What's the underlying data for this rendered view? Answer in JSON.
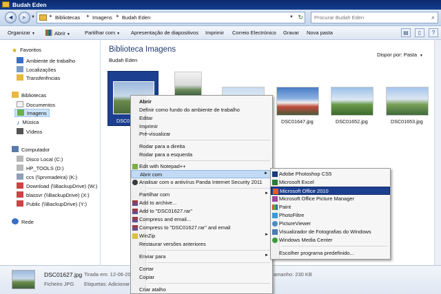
{
  "window": {
    "title": "Budah Eden"
  },
  "address": {
    "breadcrumbs": [
      "Bibliotecas",
      "Imagens",
      "Budah Eden"
    ],
    "search_placeholder": "Procurar Budah Eden"
  },
  "toolbar": {
    "items": [
      "Organizar",
      "Abrir",
      "Partilhar com",
      "Apresentação de diapositivos",
      "Imprimir",
      "Correio Electrónico",
      "Gravar",
      "Nova pasta"
    ]
  },
  "sidebar": {
    "favorites": {
      "label": "Favoritos",
      "items": [
        "Ambiente de trabalho",
        "Localizações",
        "Transferências"
      ]
    },
    "libraries": {
      "label": "Bibliotecas",
      "items": [
        "Documentos",
        "Imagens",
        "Música",
        "Vídeos"
      ]
    },
    "computer": {
      "label": "Computador",
      "items": [
        "Disco Local (C:)",
        "HP_TOOLS (D:)",
        "ccs (\\\\prvmadeira) (K:)",
        "Download (\\\\BackupDrive) (W:)",
        "blassvr (\\\\BackupDrive) (X:)",
        "Public (\\\\BackupDrive) (Y:)"
      ]
    },
    "network": {
      "label": "Rede"
    }
  },
  "main": {
    "library_title": "Biblioteca Imagens",
    "library_subtitle": "Budah Eden",
    "arrange_label": "Dispor por:",
    "arrange_value": "Pasta",
    "files": [
      {
        "name": "DSC0",
        "selected": true
      },
      {
        "name": "",
        "selected": false
      },
      {
        "name": "",
        "selected": false
      },
      {
        "name": "DSC01647.jpg",
        "selected": false
      },
      {
        "name": "DSC01652.jpg",
        "selected": false
      },
      {
        "name": "DSC01653.jpg",
        "selected": false
      }
    ]
  },
  "details": {
    "filename": "DSC01627.jpg",
    "filetype": "Ficheiro JPG",
    "date_label": "Tirada em: 12-06-20",
    "tags_label": "Etiquetas: Adicionar",
    "size_label": "amanho: 230 KB"
  },
  "context_menu": {
    "items": [
      {
        "label": "Abrir",
        "bold": true
      },
      {
        "label": "Definir como fundo do ambiente de trabalho"
      },
      {
        "label": "Editar"
      },
      {
        "label": "Imprimir"
      },
      {
        "label": "Pré-visualizar"
      },
      {
        "label": "Rodar para a direita"
      },
      {
        "label": "Rodar para a esquerda"
      },
      {
        "label": "Edit with Notepad++"
      },
      {
        "label": "Abrir com",
        "highlighted": true,
        "submenu": true
      },
      {
        "label": "Analisar com o antivírus Panda Internet Security 2011"
      },
      {
        "label": "Partilhar com",
        "submenu": true
      },
      {
        "label": "Add to archive..."
      },
      {
        "label": "Add to \"DSC01627.rar\""
      },
      {
        "label": "Compress and email..."
      },
      {
        "label": "Compress to \"DSC01627.rar\" and email"
      },
      {
        "label": "WinZip",
        "submenu": true
      },
      {
        "label": "Restaurar versões anteriores"
      },
      {
        "label": "Enviar para",
        "submenu": true
      },
      {
        "label": "Cortar"
      },
      {
        "label": "Copiar"
      },
      {
        "label": "Criar atalho"
      }
    ]
  },
  "open_with_menu": {
    "items": [
      {
        "label": "Adobe Photoshop CS5"
      },
      {
        "label": "Microsoft Excel"
      },
      {
        "label": "Microsoft Office 2010",
        "highlighted": true
      },
      {
        "label": "Microsoft Office Picture Manager"
      },
      {
        "label": "Paint"
      },
      {
        "label": "PhotoFiltre"
      },
      {
        "label": "PictureViewer"
      },
      {
        "label": "Visualizador de Fotografias do Windows"
      },
      {
        "label": "Windows Media Center"
      },
      {
        "label": "Escolher programa predefinido..."
      }
    ]
  },
  "colors": {
    "title_bar": "#0a2a6e",
    "selection_blue": "#1c3f8f",
    "menu_highlight": "#c2daf6",
    "folder_yellow": "#e8b840"
  }
}
